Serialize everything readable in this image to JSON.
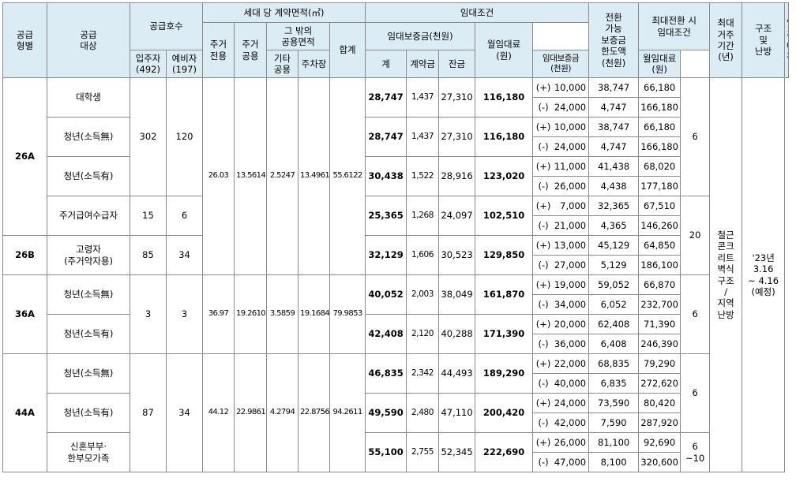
{
  "headers": {
    "type": "공급\n형별",
    "target": "공급\n대상",
    "supply_units": "공급호수",
    "tenants": "입주자\n(492)",
    "reserve": "예비자\n(197)",
    "area_per_unit": "세대 당 계약면적(㎡)",
    "exclusive": "주거\n전용",
    "common": "주거\n공용",
    "other_common_group": "그 밖의\n공용면적",
    "other_common": "기타\n공용",
    "parking": "주차장",
    "total_area": "합계",
    "lease_terms": "임대조건",
    "deposit": "임대보증금(천원)",
    "deposit_total": "계",
    "down_payment": "계약금",
    "balance": "잔금",
    "monthly_rent": "월임대료\n(원)",
    "convertible": "전환\n가능\n보증금\n한도액\n(천원)",
    "max_conversion": "최대전환 시\n임대조건",
    "max_deposit": "임대보증금\n(천원)",
    "max_rent": "월임대료\n(원)",
    "max_residence": "최대\n거주\n기간\n(년)",
    "structure": "구조\n및\n난방",
    "move_in": "입주\n예정"
  },
  "types": {
    "t26a": "26A",
    "t26b": "26B",
    "t36a": "36A",
    "t44a": "44A"
  },
  "targets": {
    "student": "대학생",
    "youth_no_income_1": "청년(소득無)",
    "youth_income_1": "청년(소득有)",
    "housing_benefit": "주거급여수급자",
    "elderly": "고령자\n(주거약자용)",
    "youth_no_income_2": "청년(소득無)",
    "youth_income_2": "청년(소득有)",
    "youth_no_income_3": "청년(소득無)",
    "youth_income_3": "청년(소득有)",
    "newlyweds": "신혼부부·\n한부모가족"
  },
  "units": {
    "t26a_group_tenants": "302",
    "t26a_group_reserve": "120",
    "housing_benefit_tenants": "15",
    "housing_benefit_reserve": "6",
    "elderly_tenants": "85",
    "elderly_reserve": "34",
    "t36a_tenants": "3",
    "t36a_reserve": "3",
    "t44a_tenants": "87",
    "t44a_reserve": "34"
  },
  "areas": {
    "t26": {
      "exclusive": "26.03",
      "common": "13.5614",
      "other": "2.5247",
      "parking": "13.4961",
      "total": "55.6122"
    },
    "t36": {
      "exclusive": "36.97",
      "common": "19.2610",
      "other": "3.5859",
      "parking": "19.1684",
      "total": "79.9853"
    },
    "t44": {
      "exclusive": "44.12",
      "common": "22.9861",
      "other": "4.2794",
      "parking": "22.8756",
      "total": "94.2611"
    }
  },
  "rows": [
    {
      "deposit": "28,747",
      "down": "1,437",
      "balance": "27,310",
      "rent": "116,180",
      "conv": [
        {
          "sign": "(+)",
          "amt": "10,000",
          "dep": "38,747",
          "rent": "66,180"
        },
        {
          "sign": "(-)",
          "amt": "24,000",
          "dep": "4,747",
          "rent": "166,180"
        }
      ]
    },
    {
      "deposit": "28,747",
      "down": "1,437",
      "balance": "27,310",
      "rent": "116,180",
      "conv": [
        {
          "sign": "(+)",
          "amt": "10,000",
          "dep": "38,747",
          "rent": "66,180"
        },
        {
          "sign": "(-)",
          "amt": "24,000",
          "dep": "4,747",
          "rent": "166,180"
        }
      ]
    },
    {
      "deposit": "30,438",
      "down": "1,522",
      "balance": "28,916",
      "rent": "123,020",
      "conv": [
        {
          "sign": "(+)",
          "amt": "11,000",
          "dep": "41,438",
          "rent": "68,020"
        },
        {
          "sign": "(-)",
          "amt": "26,000",
          "dep": "4,438",
          "rent": "177,180"
        }
      ]
    },
    {
      "deposit": "25,365",
      "down": "1,268",
      "balance": "24,097",
      "rent": "102,510",
      "conv": [
        {
          "sign": "(+)",
          "amt": "7,000",
          "dep": "32,365",
          "rent": "67,510"
        },
        {
          "sign": "(-)",
          "amt": "21,000",
          "dep": "4,365",
          "rent": "146,260"
        }
      ]
    },
    {
      "deposit": "32,129",
      "down": "1,606",
      "balance": "30,523",
      "rent": "129,850",
      "conv": [
        {
          "sign": "(+)",
          "amt": "13,000",
          "dep": "45,129",
          "rent": "64,850"
        },
        {
          "sign": "(-)",
          "amt": "27,000",
          "dep": "5,129",
          "rent": "186,100"
        }
      ]
    },
    {
      "deposit": "40,052",
      "down": "2,003",
      "balance": "38,049",
      "rent": "161,870",
      "conv": [
        {
          "sign": "(+)",
          "amt": "19,000",
          "dep": "59,052",
          "rent": "66,870"
        },
        {
          "sign": "(-)",
          "amt": "34,000",
          "dep": "6,052",
          "rent": "232,700"
        }
      ]
    },
    {
      "deposit": "42,408",
      "down": "2,120",
      "balance": "40,288",
      "rent": "171,390",
      "conv": [
        {
          "sign": "(+)",
          "amt": "20,000",
          "dep": "62,408",
          "rent": "71,390"
        },
        {
          "sign": "(-)",
          "amt": "36,000",
          "dep": "6,408",
          "rent": "246,390"
        }
      ]
    },
    {
      "deposit": "46,835",
      "down": "2,342",
      "balance": "44,493",
      "rent": "189,290",
      "conv": [
        {
          "sign": "(+)",
          "amt": "22,000",
          "dep": "68,835",
          "rent": "79,290"
        },
        {
          "sign": "(-)",
          "amt": "40,000",
          "dep": "6,835",
          "rent": "272,620"
        }
      ]
    },
    {
      "deposit": "49,590",
      "down": "2,480",
      "balance": "47,110",
      "rent": "200,420",
      "conv": [
        {
          "sign": "(+)",
          "amt": "24,000",
          "dep": "73,590",
          "rent": "80,420"
        },
        {
          "sign": "(-)",
          "amt": "42,000",
          "dep": "7,590",
          "rent": "287,920"
        }
      ]
    },
    {
      "deposit": "55,100",
      "down": "2,755",
      "balance": "52,345",
      "rent": "222,690",
      "conv": [
        {
          "sign": "(+)",
          "amt": "26,000",
          "dep": "81,100",
          "rent": "92,690"
        },
        {
          "sign": "(-)",
          "amt": "47,000",
          "dep": "8,100",
          "rent": "320,600"
        }
      ]
    }
  ],
  "residence": {
    "r1": "6",
    "r2": "20",
    "r3": "6",
    "r4": "6",
    "r5": "6\n~10"
  },
  "structure_text": "철근\n콘크\n리트\n벽식\n구조\n/\n지역\n난방",
  "move_in_text": "'23년\n3.16\n~ 4.16\n(예정)",
  "colors": {
    "header_bg": "#dcecf4",
    "border": "#8a8a8a"
  }
}
